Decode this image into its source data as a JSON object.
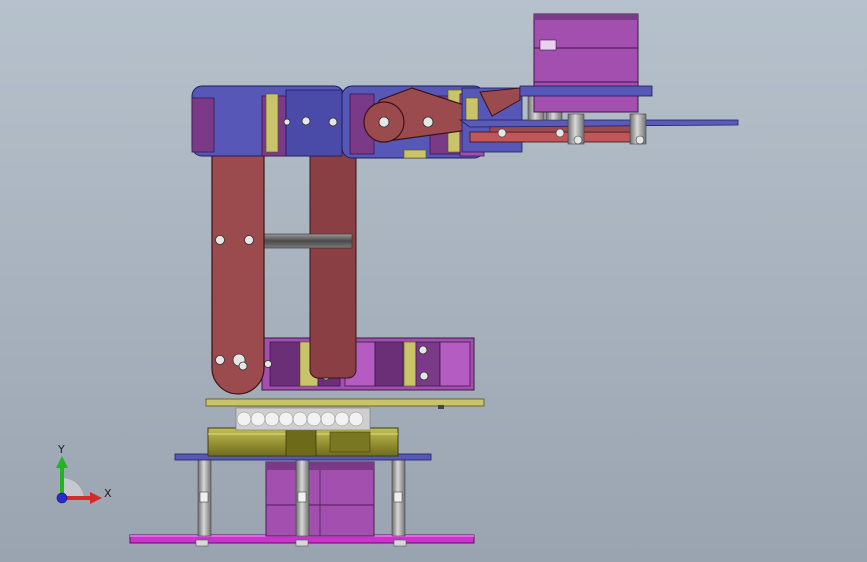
{
  "viewport": {
    "background_top": "#b6c1cc",
    "background_bottom": "#9aa4b0"
  },
  "model": {
    "parts": [
      "base-plate",
      "standoffs",
      "base-servo",
      "turntable-bearing",
      "shoulder-bracket",
      "upper-arm-link",
      "elbow-servo",
      "forearm-link",
      "wrist-servo",
      "gripper-plate"
    ],
    "colors": {
      "link": "#9b4a4e",
      "servo": "#a24fb0",
      "servo_dark": "#6b2f78",
      "bracket_blue": "#5757b8",
      "plate_yellow": "#c9c46a",
      "base_magenta": "#cc33cc",
      "post": "#9a9a9a",
      "olive": "#8d8a28"
    }
  },
  "triad": {
    "y_label": "Y",
    "x_label": "X",
    "y_color": "#22b422",
    "x_color": "#d42a2a",
    "z_color": "#2a2ad4"
  }
}
